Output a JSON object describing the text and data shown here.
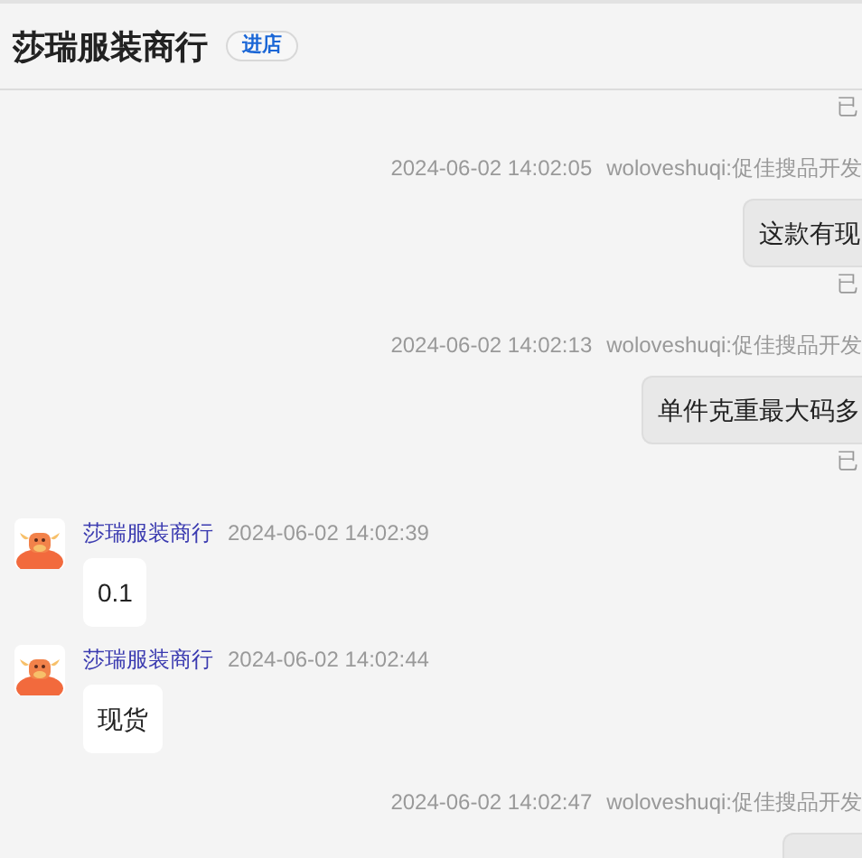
{
  "header": {
    "title": "莎瑞服装商行",
    "badge": "进店"
  },
  "messages": [
    {
      "kind": "read_mark",
      "text": "已"
    },
    {
      "kind": "outgoing",
      "time": "2024-06-02 14:02:05",
      "sender": "woloveshuqi:促佳搜品开发",
      "text": "这款有现"
    },
    {
      "kind": "read_mark",
      "text": "已"
    },
    {
      "kind": "outgoing",
      "time": "2024-06-02 14:02:13",
      "sender": "woloveshuqi:促佳搜品开发",
      "text": "单件克重最大码多"
    },
    {
      "kind": "read_mark",
      "text": "已"
    },
    {
      "kind": "incoming",
      "sender": "莎瑞服装商行",
      "time": "2024-06-02 14:02:39",
      "text": "0.1"
    },
    {
      "kind": "incoming",
      "sender": "莎瑞服装商行",
      "time": "2024-06-02 14:02:44",
      "text": "现货"
    },
    {
      "kind": "outgoing",
      "time": "2024-06-02 14:02:47",
      "sender": "woloveshuqi:促佳搜品开发"
    }
  ]
}
